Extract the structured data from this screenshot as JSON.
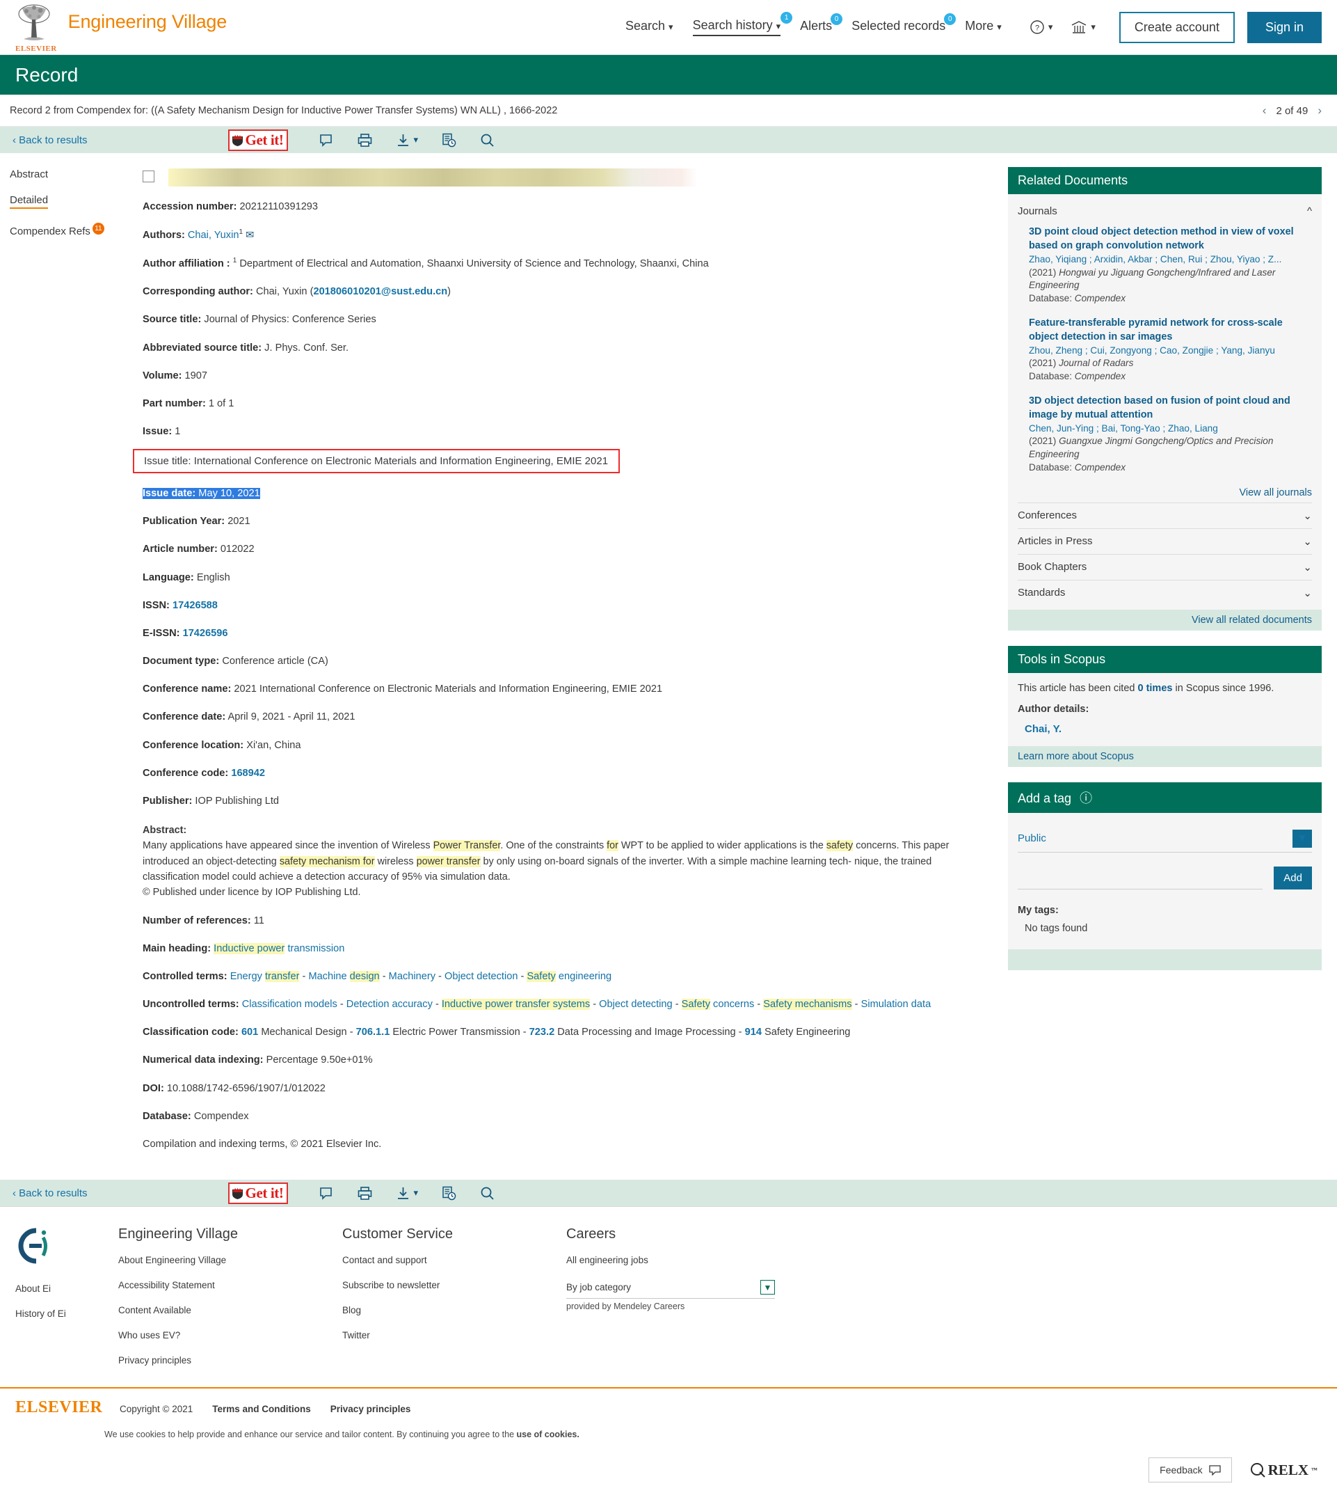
{
  "header": {
    "brand": "Engineering Village",
    "elsevier_word": "ELSEVIER",
    "nav": [
      {
        "label": "Search",
        "caret": "⌄",
        "badge": null,
        "active": false
      },
      {
        "label": "Search history",
        "caret": "⌄",
        "badge": "1",
        "active": true
      },
      {
        "label": "Alerts",
        "caret": "",
        "badge": "0",
        "active": false
      },
      {
        "label": "Selected records",
        "caret": "",
        "badge": "0",
        "active": false
      },
      {
        "label": "More",
        "caret": "⌄",
        "badge": null,
        "active": false
      }
    ],
    "help_icon": "question-circle-icon",
    "institution_icon": "bank-icon",
    "create_account": "Create account",
    "sign_in": "Sign in"
  },
  "banner": {
    "title": "Record"
  },
  "recordline": {
    "text": "Record 2 from Compendex for: ((A Safety Mechanism Design for Inductive Power Transfer Systems) WN ALL) , 1666-2022",
    "pager": "2 of 49",
    "prev": "‹",
    "next": "›"
  },
  "actionbar": {
    "back": "‹ Back to results",
    "getit": "Get it!",
    "icons": [
      "comment-icon",
      "print-icon",
      "download-icon",
      "citation-history-icon",
      "search-icon"
    ]
  },
  "leftnav": {
    "items": [
      {
        "label": "Abstract",
        "active": false,
        "badge": null
      },
      {
        "label": "Detailed",
        "active": true,
        "badge": null
      },
      {
        "label": "Compendex Refs",
        "active": false,
        "badge": "11"
      }
    ]
  },
  "record": {
    "title_redacted": "A Safety Mechanism Design for Inductive Power Transfer Systems",
    "fields": [
      {
        "label": "Accession number:",
        "value": " 20212110391293"
      },
      {
        "label": "Authors:",
        "value": " Chai, Yuxin"
      },
      {
        "label": "Author affiliation :",
        "value": " Department of Electrical and Automation, Shaanxi University of Science and Technology, Shaanxi, China"
      },
      {
        "label": "Corresponding author:",
        "value": " Chai, Yuxin (201806010201@sust.edu.cn)"
      },
      {
        "label": "Source title:",
        "value": " Journal of Physics: Conference Series"
      },
      {
        "label": "Abbreviated source title:",
        "value": " J. Phys. Conf. Ser."
      },
      {
        "label": "Volume:",
        "value": " 1907"
      },
      {
        "label": "Part number:",
        "value": " 1 of 1"
      },
      {
        "label": "Issue:",
        "value": " 1"
      }
    ],
    "author_name": "Chai, Yuxin",
    "author_sup": "1",
    "author_mail_icon": "envelope-icon",
    "affiliation_sup": "1",
    "corresponding_name": "Chai, Yuxin",
    "corresponding_email": "201806010201@sust.edu.cn",
    "issue_title_label": "Issue title:",
    "issue_title_value": " International Conference on Electronic Materials and Information Engineering, EMIE 2021",
    "issue_date_label": "Issue date:",
    "issue_date_value": " May 10, 2021",
    "fields2": [
      {
        "label": "Publication Year:",
        "value": " 2021"
      },
      {
        "label": "Article number:",
        "value": " 012022"
      },
      {
        "label": "Language:",
        "value": " English"
      }
    ],
    "issn_label": "ISSN:",
    "issn_value": "17426588",
    "eissn_label": "E-ISSN:",
    "eissn_value": "17426596",
    "fields3": [
      {
        "label": "Document type:",
        "value": " Conference article (CA)"
      },
      {
        "label": "Conference name:",
        "value": " 2021 International Conference on Electronic Materials and Information Engineering, EMIE 2021"
      },
      {
        "label": "Conference date:",
        "value": " April 9, 2021 - April 11, 2021"
      },
      {
        "label": "Conference location:",
        "value": " Xi'an, China"
      }
    ],
    "conf_code_label": "Conference code:",
    "conf_code_value": "168942",
    "publisher_label": "Publisher:",
    "publisher_value": " IOP Publishing Ltd",
    "abstract_label": "Abstract:",
    "abstract_parts": [
      {
        "t": "Many applications have appeared since the invention of Wireless ",
        "hl": false
      },
      {
        "t": "Power Transfer",
        "hl": true
      },
      {
        "t": ". One of the constraints ",
        "hl": false
      },
      {
        "t": "for",
        "hl": true
      },
      {
        "t": " WPT to be applied to wider applications is the ",
        "hl": false
      },
      {
        "t": "safety",
        "hl": true
      },
      {
        "t": " concerns. This paper introduced an object-detecting ",
        "hl": false
      },
      {
        "t": "safety mechanism for",
        "hl": true
      },
      {
        "t": " wireless ",
        "hl": false
      },
      {
        "t": "power transfer",
        "hl": true
      },
      {
        "t": " by only using on-board signals of the inverter. With a simple machine learning tech- nique, the trained classification model could achieve a detection accuracy of 95% via simulation data.",
        "hl": false
      }
    ],
    "abstract_licence": "© Published under licence by IOP Publishing Ltd.",
    "num_refs_label": "Number of references:",
    "num_refs_value": " 11",
    "main_heading_label": "Main heading:",
    "main_heading_hl": "Inductive power",
    "main_heading_rest": " transmission",
    "controlled_label": "Controlled terms:",
    "controlled_terms": [
      [
        {
          "t": "Energy ",
          "hl": false
        },
        {
          "t": "transfer",
          "hl": true
        }
      ],
      [
        {
          "t": "Machine ",
          "hl": false
        },
        {
          "t": "design",
          "hl": true
        }
      ],
      [
        {
          "t": "Machinery",
          "hl": false
        }
      ],
      [
        {
          "t": "Object detection",
          "hl": false
        }
      ],
      [
        {
          "t": "Safety",
          "hl": true
        },
        {
          "t": " engineering",
          "hl": false
        }
      ]
    ],
    "uncontrolled_label": "Uncontrolled terms:",
    "uncontrolled_terms": [
      [
        {
          "t": "Classification models",
          "hl": false
        }
      ],
      [
        {
          "t": "Detection accuracy",
          "hl": false
        }
      ],
      [
        {
          "t": "Inductive power transfer systems",
          "hl": true
        }
      ],
      [
        {
          "t": "Object detecting",
          "hl": false
        }
      ],
      [
        {
          "t": "Safety",
          "hl": true
        },
        {
          "t": " concerns",
          "hl": false
        }
      ],
      [
        {
          "t": "Safety",
          "hl": true
        },
        {
          "t": " mechanisms",
          "hl": true
        }
      ],
      [
        {
          "t": "Simulation data",
          "hl": false
        }
      ]
    ],
    "class_code_label": "Classification code:",
    "class_codes": [
      {
        "code": "601",
        "name": " Mechanical Design"
      },
      {
        "code": "706.1.1",
        "name": " Electric Power Transmission"
      },
      {
        "code": "723.2",
        "name": " Data Processing and Image Processing"
      },
      {
        "code": "914",
        "name": " Safety Engineering"
      }
    ],
    "numeric_label": "Numerical data indexing:",
    "numeric_value": " Percentage 9.50e+01%",
    "doi_label": "DOI:",
    "doi_value": " 10.1088/1742-6596/1907/1/012022",
    "database_label": "Database:",
    "database_value": " Compendex",
    "compilation": "Compilation and indexing terms, © 2021 Elsevier Inc."
  },
  "rail": {
    "related": {
      "head": "Related Documents",
      "journals_label": "Journals",
      "docs": [
        {
          "title": "3D point cloud object detection method in view of voxel based on graph convolution network",
          "authors": "Zhao, Yiqiang ; Arxidin, Akbar ; Chen, Rui ; Zhou, Yiyao ; Z...",
          "year": "(2021)",
          "source": " Hongwai yu Jiguang Gongcheng/Infrared and Laser Engineering",
          "db_label": "Database:",
          "db_value": " Compendex"
        },
        {
          "title": "Feature-transferable pyramid network for cross-scale object detection in sar images",
          "authors": "Zhou, Zheng ; Cui, Zongyong ; Cao, Zongjie ; Yang, Jianyu",
          "year": "(2021)",
          "source": " Journal of Radars",
          "db_label": "Database:",
          "db_value": " Compendex"
        },
        {
          "title": "3D object detection based on fusion of point cloud and image by mutual attention",
          "authors": "Chen, Jun-Ying ; Bai, Tong-Yao ; Zhao, Liang",
          "year": "(2021)",
          "source": " Guangxue Jingmi Gongcheng/Optics and Precision Engineering",
          "db_label": "Database:",
          "db_value": " Compendex"
        }
      ],
      "view_all_journals": "View all journals",
      "sections": [
        "Conferences",
        "Articles in Press",
        "Book Chapters",
        "Standards"
      ],
      "view_all_related": "View all related documents"
    },
    "scopus": {
      "head": "Tools in Scopus",
      "cited_pre": "This article has been cited ",
      "cited_count": "0 times",
      "cited_post": " in Scopus since 1996.",
      "author_details_label": "Author details:",
      "author": "Chai, Y.",
      "learn_more": "Learn more about Scopus"
    },
    "tag": {
      "head": "Add a tag",
      "info_icon": "info-icon",
      "visibility": "Public",
      "input_value": "",
      "input_placeholder": "",
      "add_label": "Add",
      "my_tags_label": "My tags:",
      "no_tags": "No tags found"
    }
  },
  "footer": {
    "left": {
      "logo_icon": "ei-logo-icon",
      "links": [
        "About Ei",
        "History of Ei"
      ]
    },
    "columns": [
      {
        "head": "Engineering Village",
        "links": [
          "About Engineering Village",
          "Accessibility Statement",
          "Content Available",
          "Who uses EV?",
          "Privacy principles"
        ]
      },
      {
        "head": "Customer Service",
        "links": [
          "Contact and support",
          "Subscribe to newsletter",
          "Blog",
          "Twitter"
        ]
      }
    ],
    "careers": {
      "head": "Careers",
      "all_jobs": "All engineering jobs",
      "job_category": "By job category",
      "provided_by": "provided by Mendeley Careers"
    },
    "bottom": {
      "elsevier": "ELSEVIER",
      "copyright": "Copyright © 2021",
      "links": [
        "Terms and Conditions",
        "Privacy principles"
      ],
      "cookie_pre": "We use cookies to help provide and enhance our service and tailor content. By continuing you agree to the ",
      "cookie_link": "use of cookies."
    },
    "feedback": "Feedback",
    "feedback_icon": "comment-icon",
    "relx": "RELX",
    "relx_tm": "™"
  }
}
